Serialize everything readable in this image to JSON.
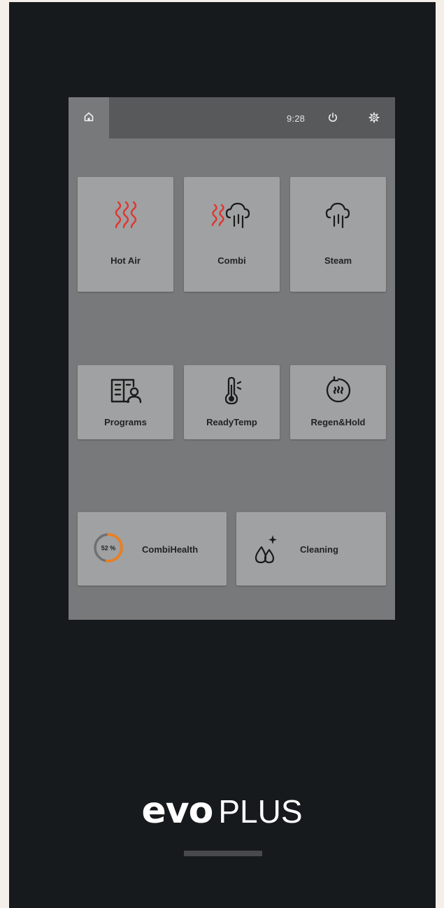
{
  "status_bar": {
    "time": "9:28",
    "icons": [
      "home-icon",
      "power-icon",
      "settings-icon"
    ]
  },
  "modes": [
    {
      "label": "Hot Air",
      "icon": "heat-waves-icon"
    },
    {
      "label": "Combi",
      "icon": "heat-steam-icon"
    },
    {
      "label": "Steam",
      "icon": "steam-cloud-icon"
    }
  ],
  "functions": [
    {
      "label": "Programs",
      "icon": "recipe-book-icon"
    },
    {
      "label": "ReadyTemp",
      "icon": "thermometer-icon"
    },
    {
      "label": "Regen&Hold",
      "icon": "regen-cycle-icon"
    }
  ],
  "combihealth": {
    "label": "CombiHealth",
    "percent_text": "52 %",
    "percent": 52
  },
  "cleaning": {
    "label": "Cleaning",
    "icon": "drops-sparkle-icon"
  },
  "brand": {
    "bold": "evo",
    "light": "PLUS"
  },
  "colors": {
    "heat_red": "#e0342d",
    "health_orange": "#f07f1a",
    "tile": "#a0a1a2",
    "screen": "#77797a",
    "device": "#161a1c"
  }
}
